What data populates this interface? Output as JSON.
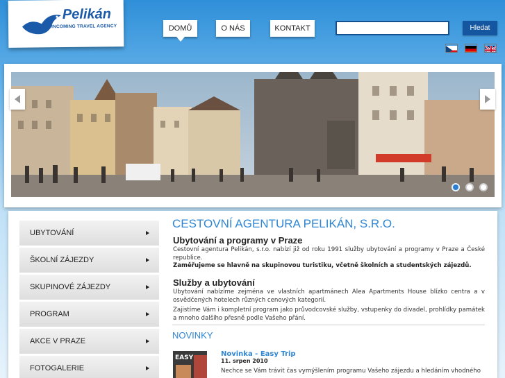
{
  "logo": {
    "name": "Pelikán",
    "tagline": "INCOMING TRAVEL AGENCY"
  },
  "nav": [
    {
      "label": "DOMŮ",
      "active": true
    },
    {
      "label": "O NÁS",
      "active": false
    },
    {
      "label": "KONTAKT",
      "active": false
    }
  ],
  "search": {
    "value": "",
    "placeholder": "",
    "button_label": "Hledat"
  },
  "languages": [
    "cs",
    "de",
    "en"
  ],
  "slider": {
    "dots": 3,
    "active_dot": 1
  },
  "sidebar": {
    "items": [
      {
        "label": "UBYTOVÁNÍ"
      },
      {
        "label": "ŠKOLNÍ ZÁJEZDY"
      },
      {
        "label": "SKUPINOVÉ ZÁJEZDY"
      },
      {
        "label": "PROGRAM"
      },
      {
        "label": "AKCE V PRAZE"
      },
      {
        "label": "FOTOGALERIE"
      }
    ]
  },
  "main": {
    "title": "CESTOVNÍ AGENTURA PELIKÁN, S.R.O.",
    "section1": {
      "heading": "Ubytování a programy v Praze",
      "text": "Cestovní agentura Pelikán, s.r.o. nabízí již od roku 1991 služby ubytování a programy v Praze a České republice.",
      "bold": "Zaměřujeme se hlavně na skupinovou turistiku, včetně školních a studentských zájezdů."
    },
    "section2": {
      "heading": "Služby a ubytování",
      "text1": "Ubytování nabízíme zejména ve vlastních apartmánech Alea Apartments House blízko centra a v osvědčených hotelech různých cenových kategorií.",
      "text2": "Zajistíme Vám i kompletní program jako průvodcovské služby, vstupenky do divadel, prohlídky památek a mnoho dalšího  přesně podle Vašeho přání."
    },
    "news_heading": "NOVINKY",
    "news": [
      {
        "title": "Novinka - Easy Trip",
        "date": "11. srpen 2010",
        "text": "Nechce se Vám trávit čas vymýšlením programu Vašeho zájezdu a hledáním vhodného",
        "thumb_label": "EASY"
      }
    ]
  },
  "colors": {
    "accent": "#2f86d3",
    "nav_dark": "#1456a0",
    "logo_blue": "#1a5aa8"
  }
}
